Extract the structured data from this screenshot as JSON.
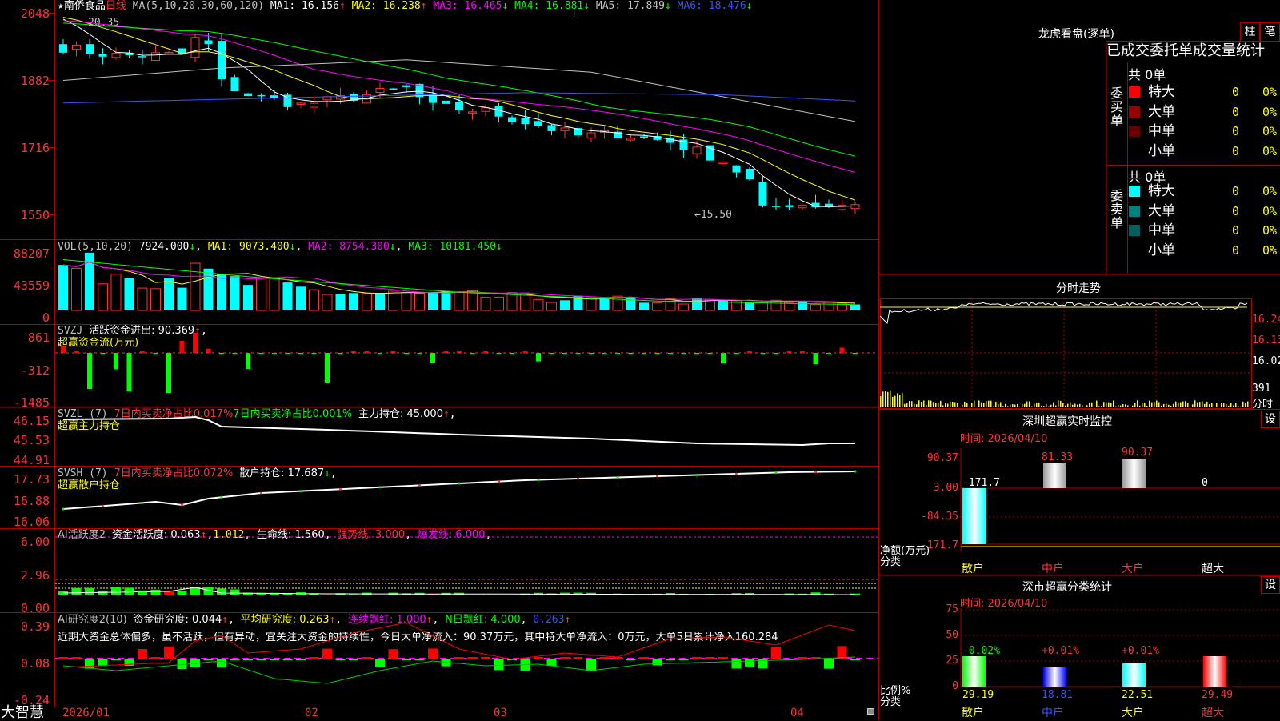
{
  "stock": {
    "star": "★",
    "name": "南侨食品",
    "period": "日线"
  },
  "main": {
    "ma_header": "MA(5,10,20,30,60,120)",
    "ma1": "MA1: 16.156",
    "ma1_arrow": "↑",
    "ma2": "MA2: 16.238",
    "ma2_arrow": "↑",
    "ma3": "MA3: 16.465",
    "ma3_arrow": "↓",
    "ma4": "MA4: 16.881",
    "ma4_arrow": "↓",
    "ma5": "MA5: 17.849",
    "ma5_arrow": "↓",
    "ma6": "MA6: 18.476",
    "ma6_arrow": "↓",
    "axis": [
      "2048",
      "1882",
      "1716",
      "1550"
    ],
    "high_label": "20.35",
    "low_label": "←15.50",
    "colors": {
      "ma1": "#ffffff",
      "ma2": "#ffff00",
      "ma3": "#ff00ff",
      "ma4": "#00ff00",
      "ma5": "#c0c0c0",
      "ma6": "#3355ff",
      "up": "#ff3232",
      "down": "#00ffff"
    }
  },
  "vol": {
    "header": "VOL(5,10,20)",
    "value": "7924.000",
    "value_arrow": "↓",
    "ma1": "MA1: 9073.400",
    "ma1_arrow": "↓",
    "ma2": "MA2: 8754.300",
    "ma2_arrow": "↓",
    "ma3": "MA3: 10181.450",
    "ma3_arrow": "↓",
    "axis": [
      "88207",
      "43559",
      "0"
    ]
  },
  "svzj": {
    "header": "SVZJ",
    "label": "活跃资金进出: 90.369",
    "arrow": "↑",
    "sep": ",",
    "sub": "超赢资金流(万元)",
    "axis": [
      "861",
      "-312",
      "-1485"
    ]
  },
  "svzl": {
    "header": "SVZL (7)",
    "a": "7日内买卖净占比0.017%",
    "b": "7日内买卖净占比0.001%",
    "c": "主力持仓: 45.000",
    "c_arrow": "↑",
    "sep": ",",
    "sub": "超赢主力持仓",
    "axis": [
      "46.15",
      "45.53",
      "44.91"
    ]
  },
  "svsh": {
    "header": "SVSH (7)",
    "a": "7日内买卖净占比0.072%",
    "c": "散户持仓: 17.687",
    "c_arrow": "↓",
    "sep": ",",
    "sub": "超赢散户持仓",
    "axis": [
      "17.73",
      "16.88",
      "16.06"
    ]
  },
  "ai_act": {
    "header": "AI活跃度2",
    "a": "资金活跃度: 0.063",
    "a_arrow": "↑",
    "b": "1.012",
    "c": "生命线: 1.560",
    "d": "强势线: 3.000",
    "e": "爆发线: 6.000",
    "sep": ",",
    "axis": [
      "6.00",
      "2.96",
      "0.00"
    ]
  },
  "ai_res": {
    "header": "AI研究度2(10)",
    "a": "资金研究度: 0.044",
    "a_arrow": "↑",
    "b": "平均研究度: 0.263",
    "b_arrow": "↑",
    "c": "连续飘红: 1.000",
    "c_arrow": "↑",
    "d": "N日飘红: 4.000",
    "e": "0.263",
    "e_arrow": "↑",
    "sep": ",",
    "comment": "近期大资金总体偏多，虽不活跃，但有异动，宜关注大资金的持续性，今日大单净流入：90.37万元，其中特大单净流入：0万元，大单5日累计净入160.284",
    "axis": [
      "0.39",
      "0.08",
      "-0.24"
    ]
  },
  "dates": [
    "2026/01",
    "02",
    "03",
    "04"
  ],
  "brand": "大智慧",
  "right": {
    "title": "龙虎看盘(逐单)",
    "btn_a": "柱",
    "btn_b": "笔",
    "tabs": [
      "已成交",
      "委托单",
      "成交量",
      "统计"
    ],
    "buy": {
      "side": "委买单",
      "total": "共 0单",
      "rows": [
        {
          "name": "特大",
          "count": "0",
          "pct": "0%",
          "color": "#ff0000"
        },
        {
          "name": "大单",
          "count": "0",
          "pct": "0%",
          "color": "#990000"
        },
        {
          "name": "中单",
          "count": "0",
          "pct": "0%",
          "color": "#660000"
        },
        {
          "name": "小单",
          "count": "0",
          "pct": "0%",
          "color": "#000000"
        }
      ]
    },
    "sell": {
      "side": "委卖单",
      "total": "共 0单",
      "rows": [
        {
          "name": "特大",
          "count": "0",
          "pct": "0%",
          "color": "#00ffff"
        },
        {
          "name": "大单",
          "count": "0",
          "pct": "0%",
          "color": "#008080"
        },
        {
          "name": "中单",
          "count": "0",
          "pct": "0%",
          "color": "#006060"
        },
        {
          "name": "小单",
          "count": "0",
          "pct": "0%",
          "color": "#000000"
        }
      ]
    },
    "intraday": {
      "title": "分时走势",
      "p1": "16.24",
      "p2": "16.13",
      "p3": "16.02",
      "vol": "391",
      "unit": "分时"
    },
    "monitor": {
      "title": "深圳超赢实时监控",
      "settings": "设",
      "time": "时间: 2026/04/10",
      "axis": [
        "90.37",
        "3.00",
        "-84.35",
        "-171.7"
      ],
      "values": {
        "retail": "-171.7",
        "mid": "81.33",
        "big": "90.37",
        "super": "0"
      },
      "unit_a": "净额(万元)",
      "unit_b": "分类",
      "cats": [
        "散户",
        "中户",
        "大户",
        "超大"
      ]
    },
    "stats": {
      "title": "深市超赢分类统计",
      "settings": "设",
      "time": "时间: 2026/04/10",
      "axis": [
        "75",
        "50",
        "25",
        "0"
      ],
      "top": [
        "-0.02%",
        "+0.01%",
        "+0.01%",
        ""
      ],
      "bottom": [
        "29.19",
        "18.81",
        "22.51",
        "29.49"
      ],
      "unit_a": "比例%",
      "unit_b": "分类",
      "cats": [
        "散户",
        "中户",
        "大户",
        "超大"
      ]
    }
  }
}
